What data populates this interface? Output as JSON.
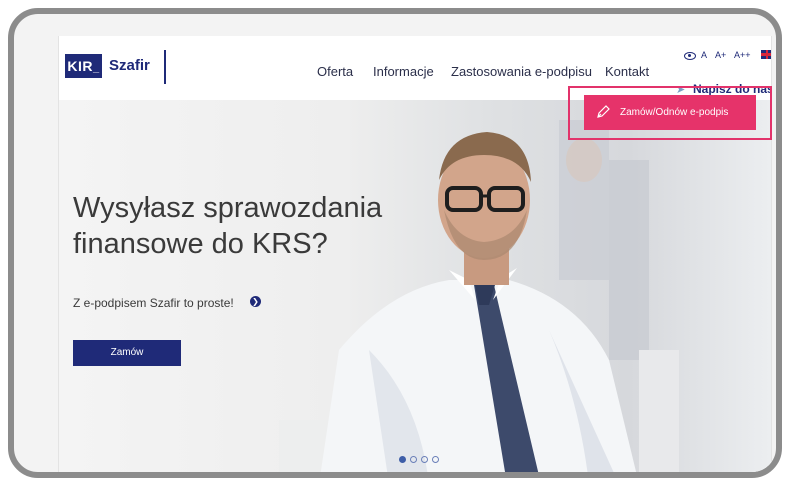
{
  "logo": {
    "kir": "KIR",
    "szafir": "Szafir"
  },
  "nav": [
    {
      "label": "Oferta"
    },
    {
      "label": "Informacje"
    },
    {
      "label": "Zastosowania e-podpisu"
    },
    {
      "label": "Kontakt"
    }
  ],
  "accessibility": {
    "font_small": "A",
    "font_medium": "A+",
    "font_large": "A++"
  },
  "contact_link": "Napisz do nas",
  "cta": {
    "label": "Zamów/Odnów e-podpis",
    "color": "#e6336a"
  },
  "hero": {
    "title": "Wysyłasz sprawozdania finansowe do KRS?",
    "subtitle": "Z e-podpisem Szafir to proste!",
    "button": "Zamów"
  },
  "carousel": {
    "slides": 4,
    "active": 1
  },
  "colors": {
    "brand": "#1f2a78",
    "accent": "#e6336a"
  },
  "icons": [
    "eye-icon",
    "flag-uk-icon",
    "paper-plane-icon",
    "pen-icon",
    "arrow-right-icon"
  ]
}
